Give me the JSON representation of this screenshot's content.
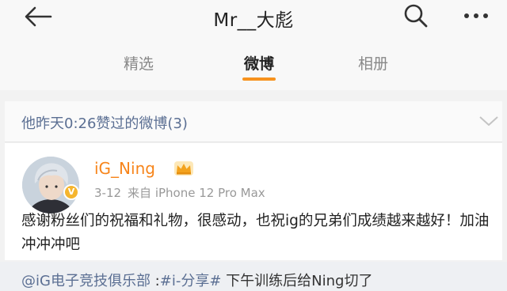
{
  "nav": {
    "title": "Mr__大彪",
    "back_icon": "arrow-left-icon",
    "search_icon": "search-icon",
    "more_icon": "more-dots-icon"
  },
  "tabs": [
    {
      "label": "精选",
      "active": false
    },
    {
      "label": "微博",
      "active": true
    },
    {
      "label": "相册",
      "active": false
    }
  ],
  "liked_header": {
    "text": "他昨天0:26赞过的微博(3)",
    "icon": "chevron-down-icon"
  },
  "post": {
    "username": "iG_Ning",
    "badge_icon": "crown-icon",
    "date": "3-12",
    "source": "来自 iPhone 12 Pro Max",
    "content": "感谢粉丝们的祝福和礼物，很感动，也祝ig的兄弟们成绩越来越好！加油冲冲冲吧"
  },
  "repost": {
    "mention": "@iG电子竞技俱乐部",
    "separator": " :",
    "hashtag": "#i-分享#",
    "text": " 下午训练后给Ning切了"
  },
  "colors": {
    "accent_orange": "#f7921e",
    "link_blue": "#5b6f93",
    "username_orange": "#f7851b"
  }
}
